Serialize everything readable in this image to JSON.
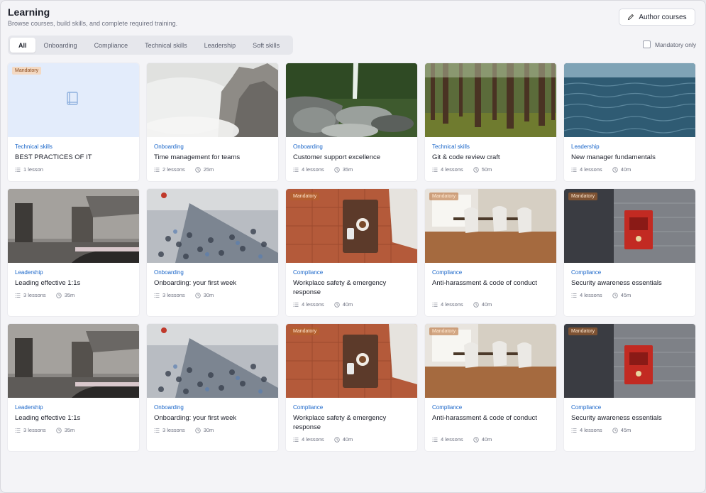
{
  "header": {
    "title": "Learning",
    "subtitle": "Browse courses, build skills, and complete required training."
  },
  "author_button": {
    "label": "Author courses",
    "icon": "pencil-icon"
  },
  "tabs": [
    "All",
    "Onboarding",
    "Compliance",
    "Technical skills",
    "Leadership",
    "Soft skills"
  ],
  "active_tab": "All",
  "mandatory_filter": {
    "label": "Mandatory only",
    "checked": false
  },
  "badge_label": "Mandatory",
  "cards": [
    {
      "category": "Technical skills",
      "title": "BEST PRACTICES OF IT",
      "lessons": "1 lesson",
      "duration": "",
      "image": "placeholder-book",
      "mandatory": true
    },
    {
      "category": "Onboarding",
      "title": "Time management for teams",
      "lessons": "2 lessons",
      "duration": "25m",
      "image": "misty-cliffs"
    },
    {
      "category": "Onboarding",
      "title": "Customer support excellence",
      "lessons": "4 lessons",
      "duration": "35m",
      "image": "waterfall"
    },
    {
      "category": "Technical skills",
      "title": "Git & code review craft",
      "lessons": "4 lessons",
      "duration": "50m",
      "image": "forest"
    },
    {
      "category": "Leadership",
      "title": "New manager fundamentals",
      "lessons": "4 lessons",
      "duration": "40m",
      "image": "water"
    },
    {
      "category": "Leadership",
      "title": "Leading effective 1:1s",
      "lessons": "3 lessons",
      "duration": "35m",
      "image": "old-building"
    },
    {
      "category": "Onboarding",
      "title": "Onboarding: your first week",
      "lessons": "3 lessons",
      "duration": "30m",
      "image": "crowd-station"
    },
    {
      "category": "Compliance",
      "title": "Workplace safety & emergency response",
      "lessons": "4 lessons",
      "duration": "40m",
      "image": "coffee-table",
      "mandatory": true
    },
    {
      "category": "Compliance",
      "title": "Anti-harassment & code of conduct",
      "lessons": "4 lessons",
      "duration": "40m",
      "image": "chairs-room",
      "mandatory": true
    },
    {
      "category": "Compliance",
      "title": "Security awareness essentials",
      "lessons": "4 lessons",
      "duration": "45m",
      "image": "red-box",
      "mandatory": true
    },
    {
      "category": "Leadership",
      "title": "Leading effective 1:1s",
      "lessons": "3 lessons",
      "duration": "35m",
      "image": "old-building"
    },
    {
      "category": "Onboarding",
      "title": "Onboarding: your first week",
      "lessons": "3 lessons",
      "duration": "30m",
      "image": "crowd-station"
    },
    {
      "category": "Compliance",
      "title": "Workplace safety & emergency response",
      "lessons": "4 lessons",
      "duration": "40m",
      "image": "coffee-table",
      "mandatory": true
    },
    {
      "category": "Compliance",
      "title": "Anti-harassment & code of conduct",
      "lessons": "4 lessons",
      "duration": "40m",
      "image": "chairs-room",
      "mandatory": true
    },
    {
      "category": "Compliance",
      "title": "Security awareness essentials",
      "lessons": "4 lessons",
      "duration": "45m",
      "image": "red-box",
      "mandatory": true
    }
  ]
}
